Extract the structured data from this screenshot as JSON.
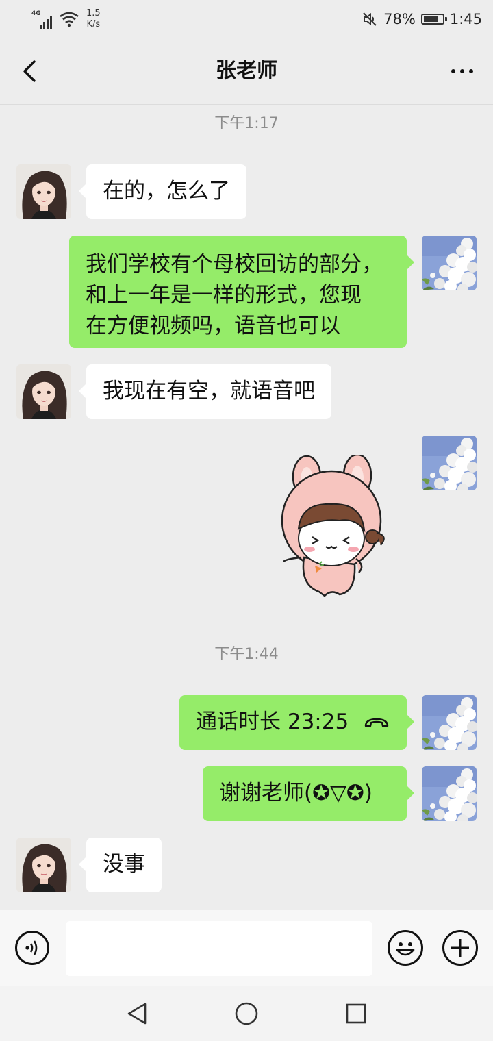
{
  "status_bar": {
    "network_type": "4G",
    "net_speed_value": "1.5",
    "net_speed_unit": "K/s",
    "battery_percent": "78%",
    "battery_level": 0.78,
    "time": "1:45",
    "icons": [
      "signal-icon",
      "wifi-icon",
      "mute-icon",
      "battery-icon"
    ]
  },
  "header": {
    "title": "张老师",
    "back_icon": "chevron-left-icon",
    "more_icon": "more-dots-icon"
  },
  "chat": {
    "timestamps": [
      "下午1:17",
      "下午1:44"
    ],
    "messages": [
      {
        "side": "in",
        "text": "在的，怎么了"
      },
      {
        "side": "out",
        "lines": [
          "我们学校有个母校回访的部分，",
          "和上一年是一样的形式，您现",
          "在方便视频吗，语音也可以"
        ]
      },
      {
        "side": "in",
        "text": "我现在有空，就语音吧"
      },
      {
        "side": "out",
        "type": "sticker",
        "sticker": "pink-bunny-sticker"
      },
      {
        "side": "out",
        "type": "call",
        "text": "通话时长 23:25",
        "icon": "phone-hangup-icon"
      },
      {
        "side": "out",
        "text": "谢谢老师(✪▽✪)"
      },
      {
        "side": "in",
        "text": "没事"
      }
    ]
  },
  "input_bar": {
    "voice_icon": "voice-icon",
    "input_value": "",
    "emoji_icon": "emoji-icon",
    "plus_icon": "plus-icon"
  },
  "nav_bar": {
    "icons": [
      "back-triangle-icon",
      "home-circle-icon",
      "recents-square-icon"
    ]
  },
  "colors": {
    "background": "#ededed",
    "outgoing_bubble": "#95ec69",
    "incoming_bubble": "#ffffff",
    "timestamp_text": "#8c8c8c"
  }
}
